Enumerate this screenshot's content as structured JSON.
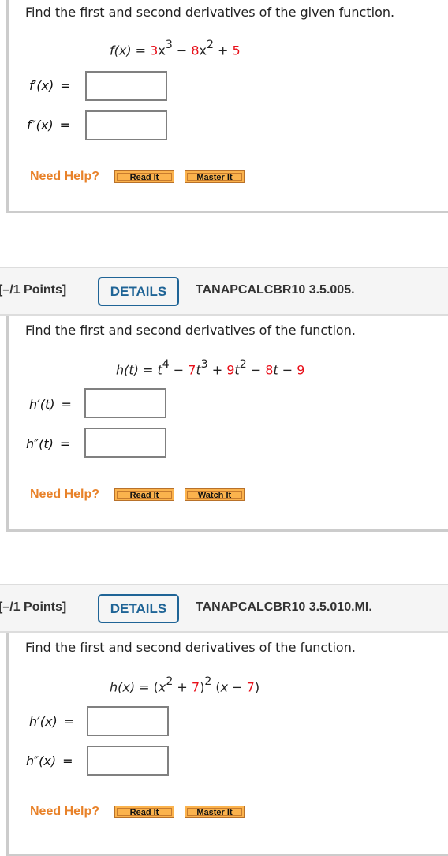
{
  "questions": [
    {
      "header": null,
      "prompt": "Find the first and second derivatives of the given function.",
      "formula": {
        "lhs": "f(x)",
        "terms": [
          "3",
          "x",
          "3",
          "8",
          "x",
          "2",
          "5"
        ]
      },
      "answers": [
        {
          "label": "f′(x)",
          "value": ""
        },
        {
          "label": "f″(x)",
          "value": ""
        }
      ],
      "help": {
        "label": "Need Help?",
        "buttons": [
          "Read It",
          "Master It"
        ]
      }
    },
    {
      "header": {
        "points": "[–/1 Points]",
        "details": "DETAILS",
        "id": "TANAPCALCBR10 3.5.005."
      },
      "prompt": "Find the first and second derivatives of the function.",
      "formula": {
        "lhs": "h(t)",
        "terms": [
          "t",
          "4",
          "7",
          "t",
          "3",
          "9",
          "t",
          "2",
          "8",
          "t",
          "9"
        ]
      },
      "answers": [
        {
          "label": "h′(t)",
          "value": ""
        },
        {
          "label": "h″(t)",
          "value": ""
        }
      ],
      "help": {
        "label": "Need Help?",
        "buttons": [
          "Read It",
          "Watch It"
        ]
      }
    },
    {
      "header": {
        "points": "[–/1 Points]",
        "details": "DETAILS",
        "id": "TANAPCALCBR10 3.5.010.MI."
      },
      "prompt": "Find the first and second derivatives of the function.",
      "formula": {
        "lhs": "h(x)",
        "terms": [
          "x",
          "2",
          "7",
          "2",
          "x",
          "7"
        ]
      },
      "answers": [
        {
          "label": "h′(x)",
          "value": ""
        },
        {
          "label": "h″(x)",
          "value": ""
        }
      ],
      "help": {
        "label": "Need Help?",
        "buttons": [
          "Read It",
          "Master It"
        ]
      }
    }
  ],
  "colors": {
    "coefficient": "#e8101a",
    "details_button": "#1f6496",
    "need_help": "#e8822a",
    "help_button": "#fbb34d"
  }
}
